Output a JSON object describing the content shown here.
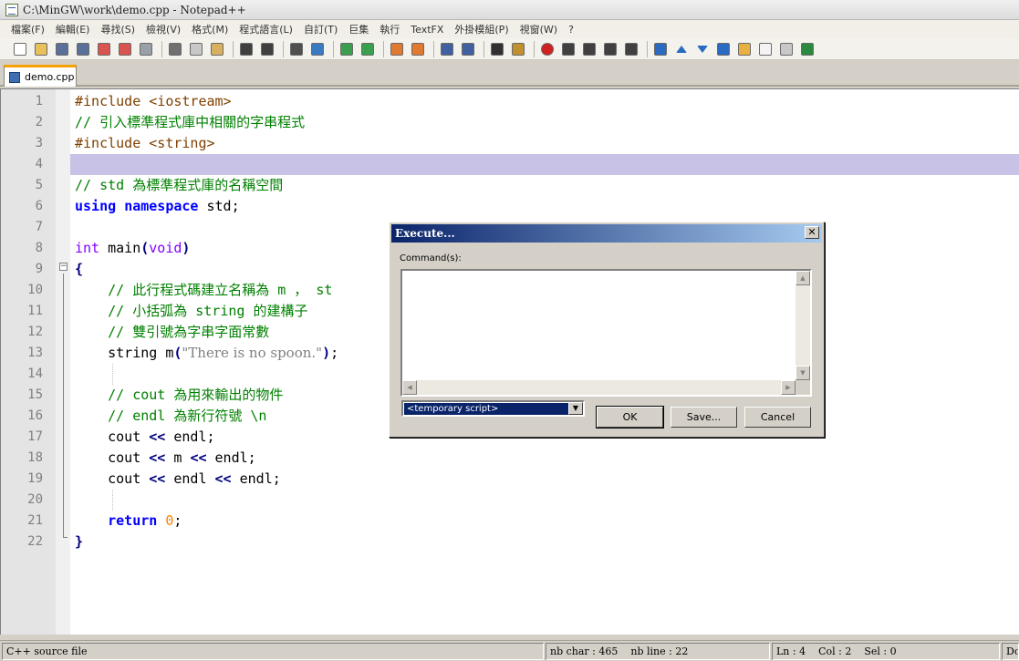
{
  "window": {
    "title": "C:\\MinGW\\work\\demo.cpp - Notepad++"
  },
  "menubar": {
    "items": [
      "檔案(F)",
      "編輯(E)",
      "尋找(S)",
      "檢視(V)",
      "格式(M)",
      "程式語言(L)",
      "自訂(T)",
      "巨集",
      "執行",
      "TextFX",
      "外掛模組(P)",
      "視窗(W)",
      "?"
    ]
  },
  "toolbar": {
    "icons": [
      "new-file-icon",
      "open-file-icon",
      "save-icon",
      "save-all-icon",
      "close-icon",
      "close-all-icon",
      "print-icon",
      "sep",
      "cut-icon",
      "copy-icon",
      "paste-icon",
      "sep",
      "undo-icon",
      "redo-icon",
      "sep",
      "find-icon",
      "replace-icon",
      "sep",
      "zoom-in-icon",
      "zoom-out-icon",
      "sep",
      "sync-vertical-icon",
      "sync-horizontal-icon",
      "sep",
      "word-wrap-icon",
      "show-all-chars-icon",
      "sep",
      "indent-guide-icon",
      "language-icon",
      "sep",
      "record-macro-icon",
      "stop-macro-icon",
      "play-macro-icon",
      "run-macro-multiple-icon",
      "save-macro-icon",
      "sep",
      "collapse-all-icon",
      "move-up-icon",
      "move-down-icon",
      "expand-all-icon",
      "open-folder-icon",
      "console-icon",
      "preview-icon",
      "spellcheck-icon"
    ]
  },
  "tabs": [
    {
      "label": "demo.cpp"
    }
  ],
  "editor": {
    "current_line": 4,
    "lines": [
      {
        "n": "1",
        "parts": [
          [
            "kw-pp",
            "#include <iostream>"
          ]
        ]
      },
      {
        "n": "2",
        "parts": [
          [
            "cm",
            "// 引入標準程式庫中相關的字串程式"
          ]
        ]
      },
      {
        "n": "3",
        "parts": [
          [
            "kw-pp",
            "#include <string>"
          ]
        ]
      },
      {
        "n": "4",
        "parts": []
      },
      {
        "n": "5",
        "parts": [
          [
            "cm",
            "// std 為標準程式庫的名稱空間"
          ]
        ]
      },
      {
        "n": "6",
        "parts": [
          [
            "kw",
            "using"
          ],
          [
            "",
            " "
          ],
          [
            "kw",
            "namespace"
          ],
          [
            "",
            " std;"
          ]
        ]
      },
      {
        "n": "7",
        "parts": []
      },
      {
        "n": "8",
        "parts": [
          [
            "kw-type",
            "int"
          ],
          [
            "",
            " main"
          ],
          [
            "paren",
            "("
          ],
          [
            "kw-type",
            "void"
          ],
          [
            "paren",
            ")"
          ]
        ]
      },
      {
        "n": "9",
        "parts": [
          [
            "paren",
            "{"
          ]
        ]
      },
      {
        "n": "10",
        "parts": [
          [
            "",
            "    "
          ],
          [
            "cm",
            "// 此行程式碼建立名稱為 m ， st"
          ]
        ]
      },
      {
        "n": "11",
        "parts": [
          [
            "",
            "    "
          ],
          [
            "cm",
            "// 小括弧為 string 的建構子"
          ]
        ]
      },
      {
        "n": "12",
        "parts": [
          [
            "",
            "    "
          ],
          [
            "cm",
            "// 雙引號為字串字面常數"
          ]
        ]
      },
      {
        "n": "13",
        "parts": [
          [
            "",
            "    string m"
          ],
          [
            "paren",
            "("
          ],
          [
            "str",
            "\"There is no spoon.\""
          ],
          [
            "paren",
            ")"
          ],
          [
            "",
            ";"
          ]
        ]
      },
      {
        "n": "14",
        "parts": []
      },
      {
        "n": "15",
        "parts": [
          [
            "",
            "    "
          ],
          [
            "cm",
            "// cout 為用來輸出的物件"
          ]
        ]
      },
      {
        "n": "16",
        "parts": [
          [
            "",
            "    "
          ],
          [
            "cm",
            "// endl 為新行符號 \\n"
          ]
        ]
      },
      {
        "n": "17",
        "parts": [
          [
            "",
            "    cout "
          ],
          [
            "op",
            "<<"
          ],
          [
            "",
            " endl;"
          ]
        ]
      },
      {
        "n": "18",
        "parts": [
          [
            "",
            "    cout "
          ],
          [
            "op",
            "<<"
          ],
          [
            "",
            " m "
          ],
          [
            "op",
            "<<"
          ],
          [
            "",
            " endl;"
          ]
        ]
      },
      {
        "n": "19",
        "parts": [
          [
            "",
            "    cout "
          ],
          [
            "op",
            "<<"
          ],
          [
            "",
            " endl "
          ],
          [
            "op",
            "<<"
          ],
          [
            "",
            " endl;"
          ]
        ]
      },
      {
        "n": "20",
        "parts": []
      },
      {
        "n": "21",
        "parts": [
          [
            "",
            "    "
          ],
          [
            "kw",
            "return"
          ],
          [
            "",
            " "
          ],
          [
            "num",
            "0"
          ],
          [
            "",
            ";"
          ]
        ]
      },
      {
        "n": "22",
        "parts": [
          [
            "paren",
            "}"
          ]
        ]
      }
    ]
  },
  "dialog": {
    "title": "Execute...",
    "close_label": "✕",
    "commands_label": "Command(s):",
    "commands_value": "",
    "script_select": "<temporary script>",
    "ok_label": "OK",
    "save_label": "Save...",
    "cancel_label": "Cancel"
  },
  "statusbar": {
    "file_type": "C++ source file",
    "nb_char": "nb char : 465",
    "nb_line": "nb line : 22",
    "ln": "Ln : 4",
    "col": "Col : 2",
    "sel": "Sel : 0",
    "eol": "Dos"
  },
  "colors": {
    "current_line": "#c8c3e6",
    "comment": "#008000",
    "keyword": "#0000ff",
    "type": "#8000ff",
    "preprocessor": "#804000",
    "tab_accent": "#f7a000",
    "dialog_title": "#0a246a"
  }
}
